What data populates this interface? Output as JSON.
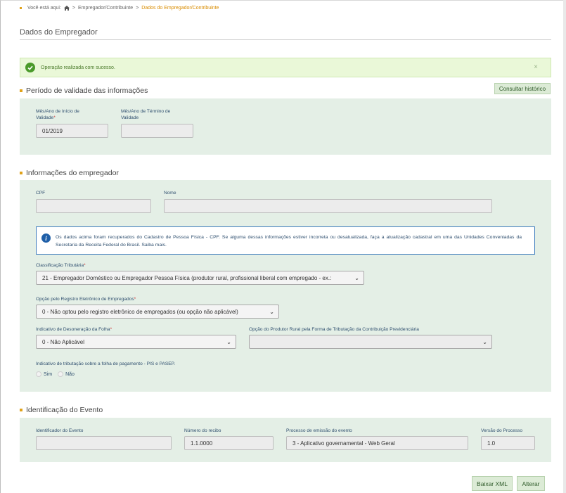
{
  "breadcrumb": {
    "prefix": "Você está aqui:",
    "separator": ">",
    "item1": "Empregador/Contribuinte",
    "current": "Dados do Empregador/Contribuinte"
  },
  "page_title": "Dados do Empregador",
  "alert": {
    "message": "Operação realizada com sucesso.",
    "close": "×"
  },
  "validity": {
    "heading": "Período de validade das informações",
    "history_button": "Consultar histórico",
    "start_label": "Mês/Ano de Início de Validade",
    "start_value": "01/2019",
    "end_label": "Mês/Ano de Término de Validade",
    "end_value": "",
    "required_mark": "*"
  },
  "employer": {
    "heading": "Informações do empregador",
    "cpf_label": "CPF",
    "cpf_value": "",
    "name_label": "Nome",
    "name_value": "",
    "info_text": "Os dados acima foram recuperados do Cadastro de Pessoa Física - CPF. Se alguma dessas informações estiver incorreta ou desatualizada, faça a atualização cadastral em uma das Unidades Conveniadas da Secretaria da Receita Federal do Brasil. Saiba mais.",
    "tax_class_label": "Classificação Tributária",
    "tax_class_value": "21 - Empregador Doméstico ou Empregador Pessoa Física (produtor rural, profissional liberal com empregado - ex.:",
    "electronic_reg_label": "Opção pelo Registro Eletrônico de Empregados",
    "electronic_reg_value": "0 - Não optou pelo registro eletrônico de empregados (ou opção não aplicável)",
    "payroll_label": "Indicativo de Desoneração da Folha",
    "payroll_value": "0 - Não Aplicável",
    "rural_label": "Opção do Produtor Rural pela Forma de Tributação da Contribuição Previdenciária",
    "rural_value": "",
    "pis_label": "Indicativo de tributação sobre a folha de pagamento - PIS e PASEP.",
    "radio_yes": "Sim",
    "radio_no": "Não",
    "required_mark": "*"
  },
  "event": {
    "heading": "Identificação do Evento",
    "id_label": "Identificador do Evento",
    "id_value": "",
    "receipt_label": "Número do recibo",
    "receipt_value": "1.1.0000",
    "process_label": "Processo de emissão do evento",
    "process_value": "3 - Aplicativo governamental - Web Geral",
    "version_label": "Versão do Processo",
    "version_value": "1.0"
  },
  "actions": {
    "download_xml": "Baixar XML",
    "edit": "Alterar"
  },
  "colors": {
    "accent": "#e0a21a",
    "panel": "#e4efe6",
    "success_bg": "#eaf8d8",
    "info_border": "#3d7bbd"
  }
}
